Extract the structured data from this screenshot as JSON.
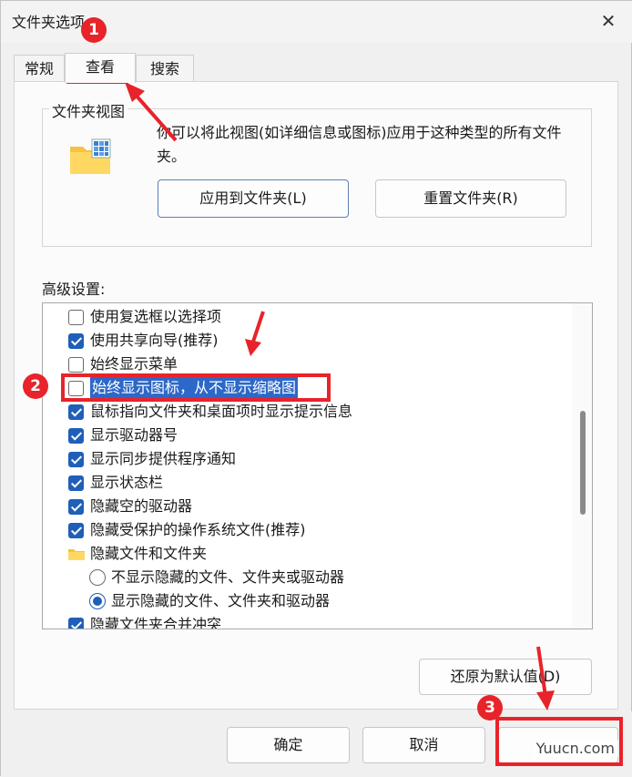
{
  "window": {
    "title": "文件夹选项",
    "close_glyph": "✕"
  },
  "tabs": [
    {
      "label": "常规"
    },
    {
      "label": "查看"
    },
    {
      "label": "搜索"
    }
  ],
  "folder_views": {
    "group_title": "文件夹视图",
    "description": "你可以将此视图(如详细信息或图标)应用于这种类型的所有文件夹。",
    "apply_label": "应用到文件夹(L)",
    "reset_label": "重置文件夹(R)"
  },
  "advanced": {
    "label": "高级设置:",
    "items": [
      {
        "type": "checkbox",
        "checked": false,
        "label": "使用复选框以选择项"
      },
      {
        "type": "checkbox",
        "checked": true,
        "label": "使用共享向导(推荐)"
      },
      {
        "type": "checkbox",
        "checked": false,
        "label": "始终显示菜单"
      },
      {
        "type": "checkbox",
        "checked": false,
        "label": "始终显示图标，从不显示缩略图",
        "selected": true
      },
      {
        "type": "checkbox",
        "checked": true,
        "label": "鼠标指向文件夹和桌面项时显示提示信息"
      },
      {
        "type": "checkbox",
        "checked": true,
        "label": "显示驱动器号"
      },
      {
        "type": "checkbox",
        "checked": true,
        "label": "显示同步提供程序通知"
      },
      {
        "type": "checkbox",
        "checked": true,
        "label": "显示状态栏"
      },
      {
        "type": "checkbox",
        "checked": true,
        "label": "隐藏空的驱动器"
      },
      {
        "type": "checkbox",
        "checked": true,
        "label": "隐藏受保护的操作系统文件(推荐)"
      },
      {
        "type": "folder",
        "label": "隐藏文件和文件夹"
      },
      {
        "type": "radio",
        "checked": false,
        "label": "不显示隐藏的文件、文件夹或驱动器"
      },
      {
        "type": "radio",
        "checked": true,
        "label": "显示隐藏的文件、文件夹和驱动器"
      },
      {
        "type": "checkbox",
        "checked": true,
        "label": "隐藏文件夹合并冲突"
      }
    ],
    "restore_label": "还原为默认值(D)"
  },
  "footer": {
    "ok_label": "确定",
    "cancel_label": "取消"
  },
  "annotations": {
    "badge1": "1",
    "badge2": "2",
    "badge3": "3",
    "color": "#e8232a"
  },
  "watermark": "Yuucn.com",
  "colors": {
    "accent": "#1f5fb9",
    "selection": "#2c68c8"
  }
}
